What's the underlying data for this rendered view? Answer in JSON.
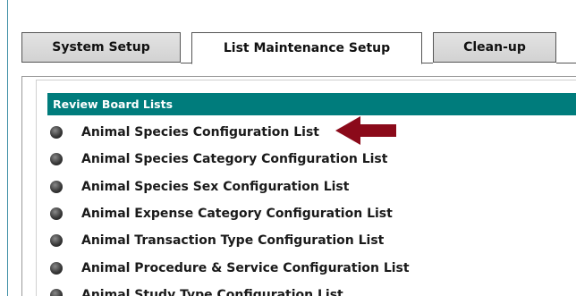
{
  "tabs": [
    {
      "label": "System Setup",
      "active": false
    },
    {
      "label": "List Maintenance Setup",
      "active": true
    },
    {
      "label": "Clean-up",
      "active": false
    }
  ],
  "section": {
    "title": "Review Board Lists"
  },
  "items": [
    {
      "label": "Animal Species Configuration List"
    },
    {
      "label": "Animal Species Category Configuration List"
    },
    {
      "label": "Animal Species Sex Configuration List"
    },
    {
      "label": "Animal Expense Category Configuration List"
    },
    {
      "label": "Animal Transaction Type Configuration List"
    },
    {
      "label": "Animal Procedure & Service Configuration List"
    },
    {
      "label": "Animal Study Type Configuration List"
    }
  ],
  "icons": {
    "bullet": "bullet-icon",
    "annotation_arrow": "left-arrow-icon"
  },
  "colors": {
    "header_bg": "#007c7c",
    "header_text": "#ffffff",
    "arrow": "#8b0a1a",
    "tab_inactive_bg": "#d8d8d8"
  }
}
